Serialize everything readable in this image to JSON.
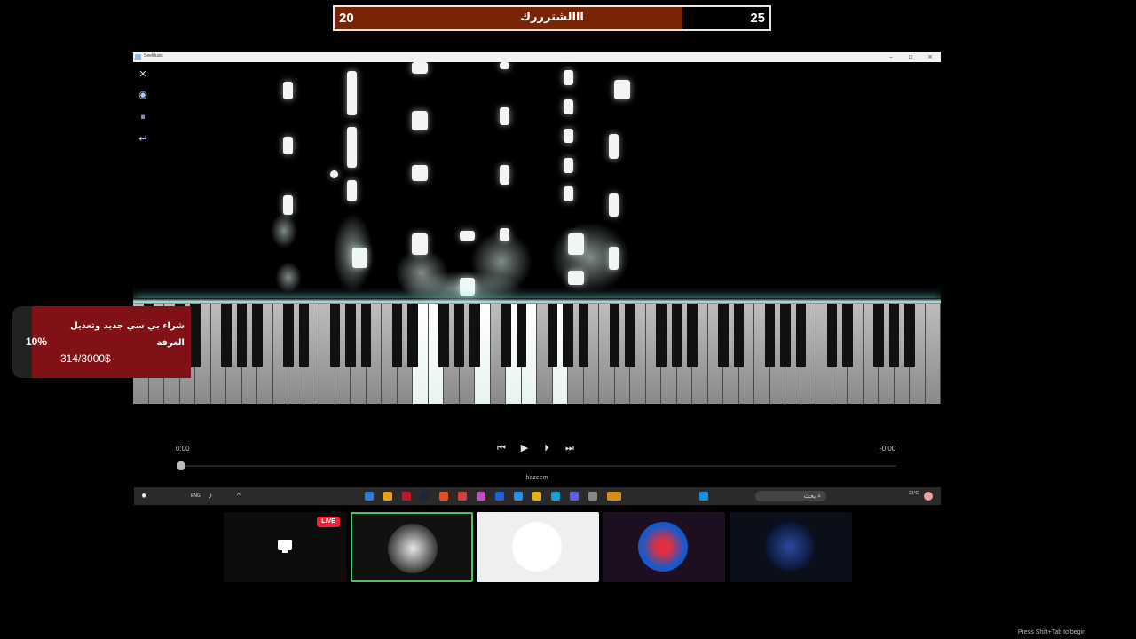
{
  "score_bar": {
    "left_score": "20",
    "right_score": "25",
    "title": "ااالشترررك",
    "fill_fraction": 0.8
  },
  "window": {
    "title": "SeeMusic"
  },
  "player": {
    "time_elapsed": "0:00",
    "time_remaining": "-0:00",
    "caption": "hazeem"
  },
  "donation_goal": {
    "percent": "10%",
    "title": "شراء بي سي جديد وتعديل الغرفة",
    "amount": "314/3000$",
    "progress_fraction": 0.1
  },
  "taskbar": {
    "lang": "ENG",
    "search_label": "بحث",
    "weather": "21°C"
  },
  "live_badge": "LIVE",
  "footer_hint": "Press Shift+Tab to begin",
  "icons": [
    "close-icon",
    "eye-icon",
    "pause-icon",
    "back-icon",
    "skip-back-icon",
    "play-icon",
    "step-forward-icon",
    "skip-forward-icon",
    "search-icon",
    "windows-icon"
  ],
  "colors": {
    "score_fill": "#7a2406",
    "goal_bg": "#821117",
    "live": "#e8283a",
    "glow": "#b8fff2",
    "active_tile_border": "#4cc35a"
  }
}
